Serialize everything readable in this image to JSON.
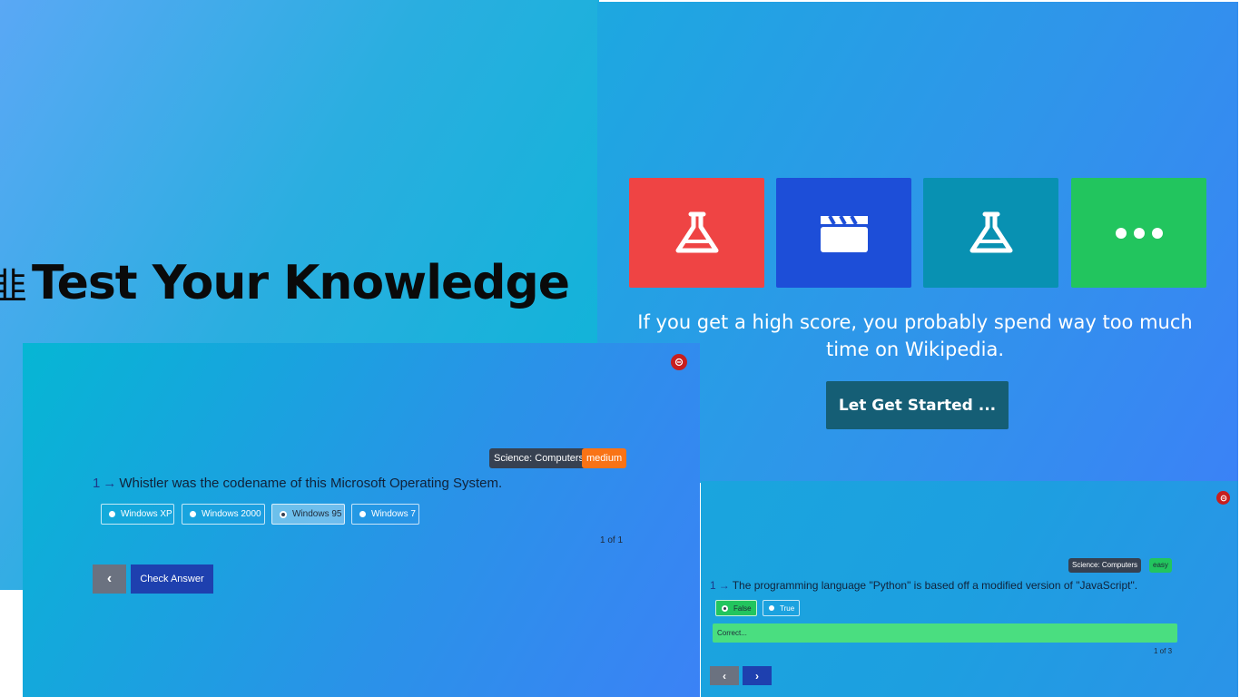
{
  "hero": {
    "glyph": "韭",
    "title": "Test Your Knowledge"
  },
  "categories": {
    "tiles": [
      {
        "icon": "flask-icon",
        "color": "#ef4444"
      },
      {
        "icon": "clapperboard-icon",
        "color": "#1d4ed8"
      },
      {
        "icon": "flask-icon",
        "color": "#0891b2"
      },
      {
        "icon": "more-dots-icon",
        "color": "#22c55e"
      }
    ],
    "tagline": "If you get a high score, you probably spend way too much time on Wikipedia.",
    "start_button": "Let Get Started ..."
  },
  "quiz_main": {
    "category": "Science: Computers",
    "difficulty": "medium",
    "difficulty_color": "#f97316",
    "number": "1",
    "arrow": "→",
    "question": "Whistler was the codename of this Microsoft Operating System.",
    "options": [
      "Windows XP",
      "Windows 2000",
      "Windows 95",
      "Windows 7"
    ],
    "selected": "Windows 95",
    "counter": "1 of 1",
    "back_label": "‹",
    "check_label": "Check Answer"
  },
  "quiz_small": {
    "category": "Science: Computers",
    "difficulty": "easy",
    "difficulty_color": "#22c55e",
    "number": "1",
    "arrow": "→",
    "question": "The programming language \"Python\" is based off a modified version of \"JavaScript\".",
    "options": [
      "False",
      "True"
    ],
    "selected": "False",
    "feedback": "Correct...",
    "counter": "1 of 3",
    "prev_label": "‹",
    "next_label": "›"
  }
}
